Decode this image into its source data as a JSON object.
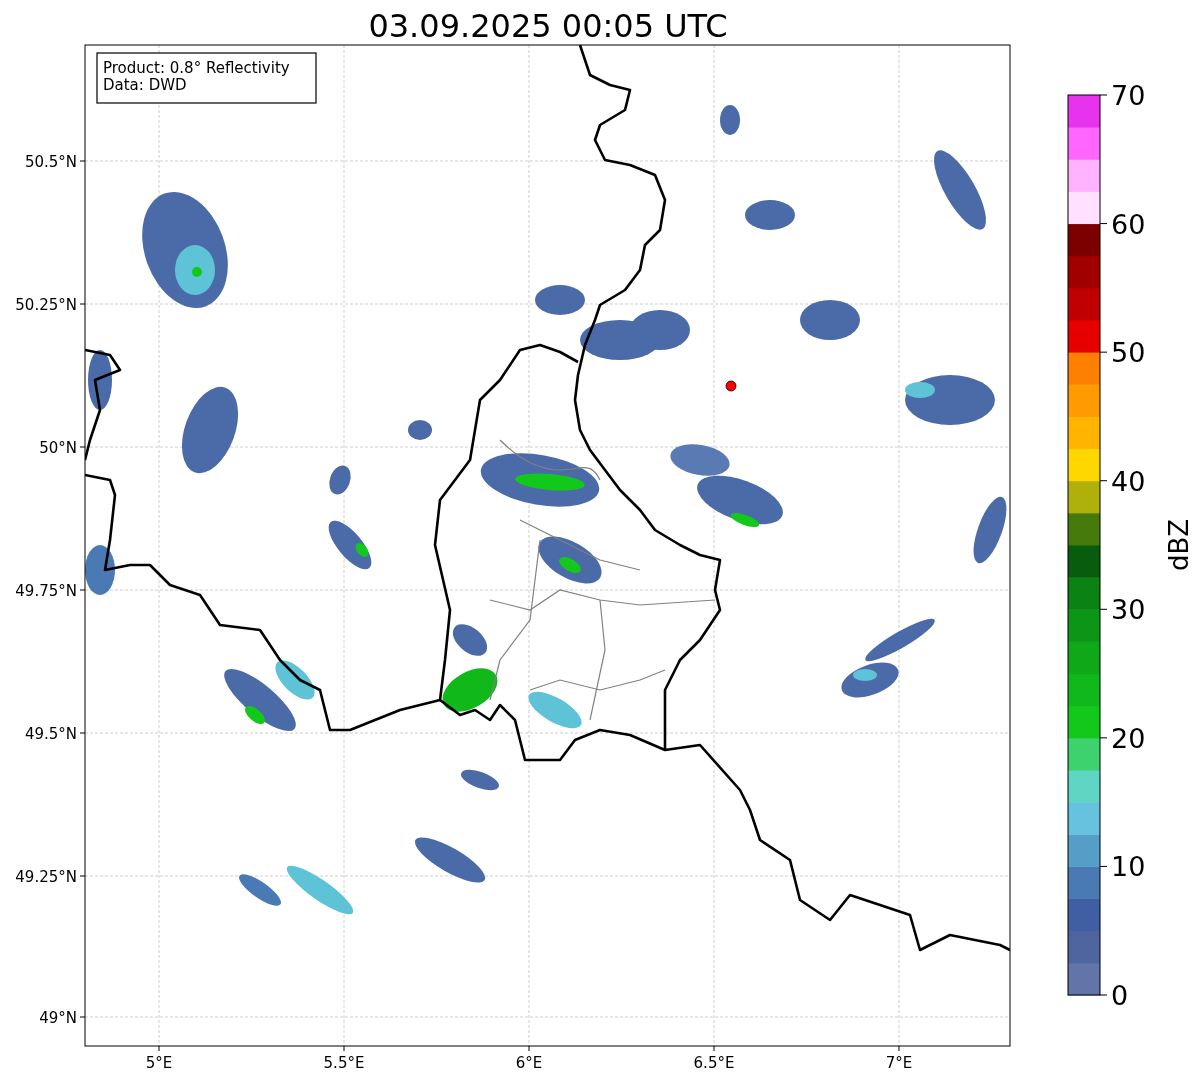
{
  "title": "03.09.2025 00:05 UTC",
  "info_box": [
    "Product: 0.8° Reflectivity",
    "Data: DWD"
  ],
  "map": {
    "y_ticks": [
      "50.5°N",
      "50.25°N",
      "50°N",
      "49.75°N",
      "49.5°N",
      "49.25°N",
      "49°N"
    ],
    "x_ticks": [
      "5°E",
      "5.5°E",
      "6°E",
      "6.5°E",
      "7°E"
    ]
  },
  "colorbar": {
    "label": "dBZ",
    "ticks": [
      "70",
      "60",
      "50",
      "40",
      "30",
      "20",
      "10",
      "0"
    ],
    "bins": [
      {
        "color": "#6374a8"
      },
      {
        "color": "#4f65a0"
      },
      {
        "color": "#3f5ea3"
      },
      {
        "color": "#4a7ab3"
      },
      {
        "color": "#559ec8"
      },
      {
        "color": "#65c3df"
      },
      {
        "color": "#5fd6c4"
      },
      {
        "color": "#3ed26e"
      },
      {
        "color": "#12c81a"
      },
      {
        "color": "#10b81c"
      },
      {
        "color": "#0ea818"
      },
      {
        "color": "#0c9616"
      },
      {
        "color": "#0a8214"
      },
      {
        "color": "#075c0d"
      },
      {
        "color": "#467a0a"
      },
      {
        "color": "#b0b00a"
      },
      {
        "color": "#ffd700"
      },
      {
        "color": "#ffb400"
      },
      {
        "color": "#ff9a00"
      },
      {
        "color": "#ff7f00"
      },
      {
        "color": "#e60000"
      },
      {
        "color": "#c00000"
      },
      {
        "color": "#a00000"
      },
      {
        "color": "#7d0000"
      },
      {
        "color": "#ffe0ff"
      },
      {
        "color": "#ffb3ff"
      },
      {
        "color": "#ff66ff"
      },
      {
        "color": "#e833ee"
      }
    ]
  }
}
